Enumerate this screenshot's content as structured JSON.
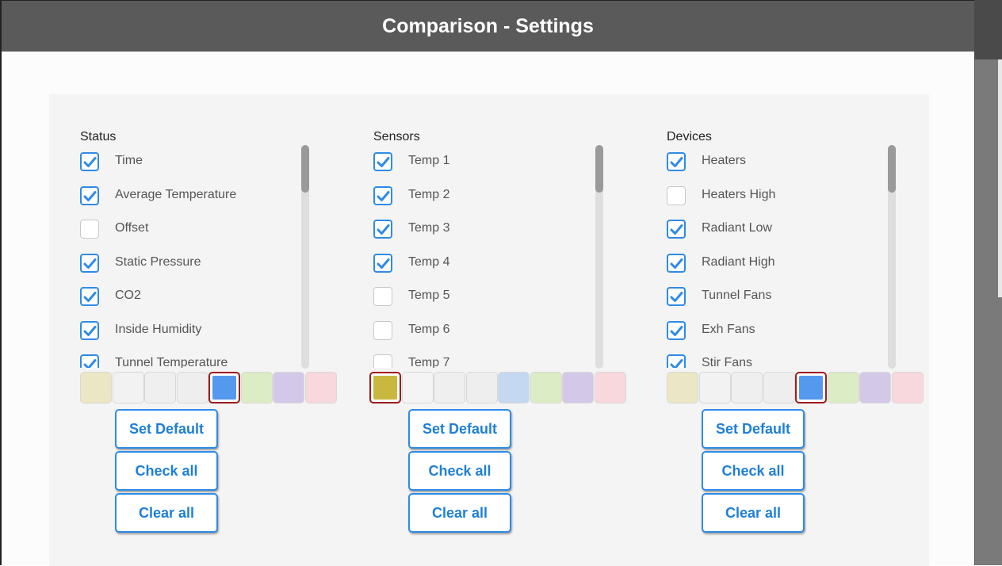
{
  "window": {
    "title": "Comparison - Settings"
  },
  "columns": [
    {
      "title": "Status",
      "items": [
        {
          "label": "Time",
          "checked": true
        },
        {
          "label": "Average Temperature",
          "checked": true
        },
        {
          "label": "Offset",
          "checked": false
        },
        {
          "label": "Static Pressure",
          "checked": true
        },
        {
          "label": "CO2",
          "checked": true
        },
        {
          "label": "Inside Humidity",
          "checked": true
        },
        {
          "label": "Tunnel Temperature",
          "checked": true
        }
      ],
      "swatches": [
        "#ebe6c4",
        "#f2f2f2",
        "#efefef",
        "#eeeeee",
        "#5599ee",
        "#dcecc4",
        "#d4c8e8",
        "#f8d8dc"
      ],
      "selected_swatch": 4,
      "buttons": {
        "set_default": "Set Default",
        "check_all": "Check all",
        "clear_all": "Clear all"
      }
    },
    {
      "title": "Sensors",
      "items": [
        {
          "label": "Temp 1",
          "checked": true
        },
        {
          "label": "Temp 2",
          "checked": true
        },
        {
          "label": "Temp 3",
          "checked": true
        },
        {
          "label": "Temp 4",
          "checked": true
        },
        {
          "label": "Temp 5",
          "checked": false
        },
        {
          "label": "Temp 6",
          "checked": false
        },
        {
          "label": "Temp 7",
          "checked": false
        }
      ],
      "swatches": [
        "#c8b840",
        "#f4f4f4",
        "#efefef",
        "#eeeeee",
        "#c4d8f2",
        "#dcecc4",
        "#d4c8e8",
        "#f8d8dc"
      ],
      "selected_swatch": 0,
      "buttons": {
        "set_default": "Set Default",
        "check_all": "Check all",
        "clear_all": "Clear all"
      }
    },
    {
      "title": "Devices",
      "items": [
        {
          "label": "Heaters",
          "checked": true
        },
        {
          "label": "Heaters High",
          "checked": false
        },
        {
          "label": "Radiant Low",
          "checked": true
        },
        {
          "label": "Radiant High",
          "checked": true
        },
        {
          "label": "Tunnel Fans",
          "checked": true
        },
        {
          "label": "Exh Fans",
          "checked": true
        },
        {
          "label": "Stir Fans",
          "checked": true
        }
      ],
      "swatches": [
        "#ebe6c4",
        "#f2f2f2",
        "#efefef",
        "#eeeeee",
        "#5599ee",
        "#dcecc4",
        "#d4c8e8",
        "#f8d8dc"
      ],
      "selected_swatch": 4,
      "buttons": {
        "set_default": "Set Default",
        "check_all": "Check all",
        "clear_all": "Clear all"
      }
    }
  ],
  "colors": {
    "accent": "#2f8be6",
    "selected_border": "#a01c1c",
    "titlebar": "#5a5a5a"
  }
}
